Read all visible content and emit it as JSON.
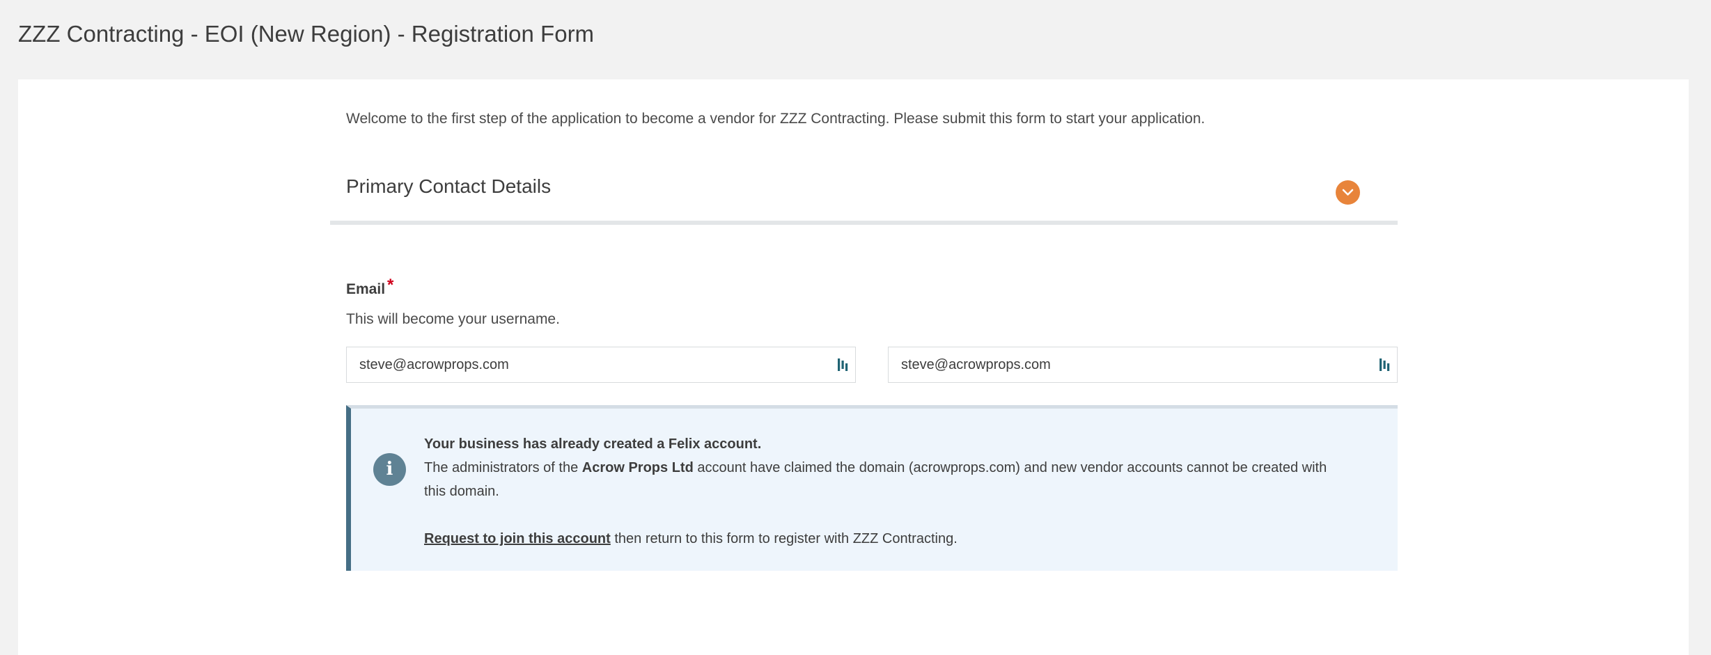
{
  "page": {
    "title": "ZZZ Contracting - EOI (New Region) - Registration Form"
  },
  "form": {
    "intro": "Welcome to the first step of the application to become a vendor for ZZZ Contracting. Please submit this form to start your application.",
    "section": {
      "title": "Primary Contact Details",
      "toggle_icon": "chevron-down-icon"
    },
    "email": {
      "label": "Email",
      "required_mark": "*",
      "help": "This will become your username.",
      "value": "steve@acrowprops.com",
      "confirm_value": "steve@acrowprops.com"
    },
    "alert": {
      "icon": "info-icon",
      "heading": "Your business has already created a Felix account.",
      "line_prefix": "The administrators of the ",
      "company": "Acrow Props Ltd",
      "line_suffix": " account have claimed the domain (acrowprops.com) and new vendor accounts cannot be created with this domain.",
      "link_text": "Request to join this account",
      "link_suffix": " then return to this form to register with ZZZ Contracting."
    }
  },
  "colors": {
    "accent": "#e8843a",
    "alert_border": "#456e85",
    "alert_background": "#eef5fc",
    "required": "#d0021b"
  }
}
